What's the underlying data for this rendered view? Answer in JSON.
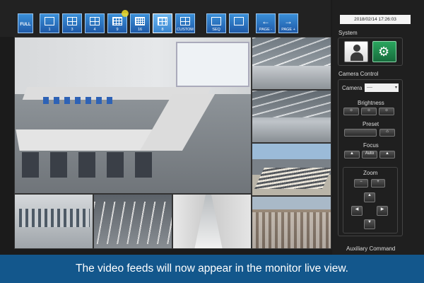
{
  "toolbar": {
    "buttons": [
      {
        "label": "FULL"
      },
      {
        "label": "1"
      },
      {
        "label": "3"
      },
      {
        "label": "4"
      },
      {
        "label": "9"
      },
      {
        "label": "16"
      },
      {
        "label": "8"
      },
      {
        "label": "CUSTOM"
      },
      {
        "label": "SEQ"
      },
      {
        "label": "PAGE -"
      },
      {
        "label": "PAGE +"
      }
    ],
    "selected_layout": "8"
  },
  "datetime": "2018/02/14 17:26:03",
  "system": {
    "title": "System"
  },
  "camera_control": {
    "title": "Camera Control",
    "camera_label": "Camera",
    "camera_value": "----",
    "brightness_label": "Brightness",
    "preset_label": "Preset",
    "focus_label": "Focus",
    "focus_auto_label": "Auto",
    "zoom_label": "Zoom"
  },
  "auxiliary": {
    "title": "Auxiliary Command"
  },
  "caption": "The video feeds will now appear in the monitor live view.",
  "colors": {
    "toolbar_button": "#2f7fd0",
    "settings_button": "#1e8a4c",
    "caption_bar": "#125c96"
  }
}
